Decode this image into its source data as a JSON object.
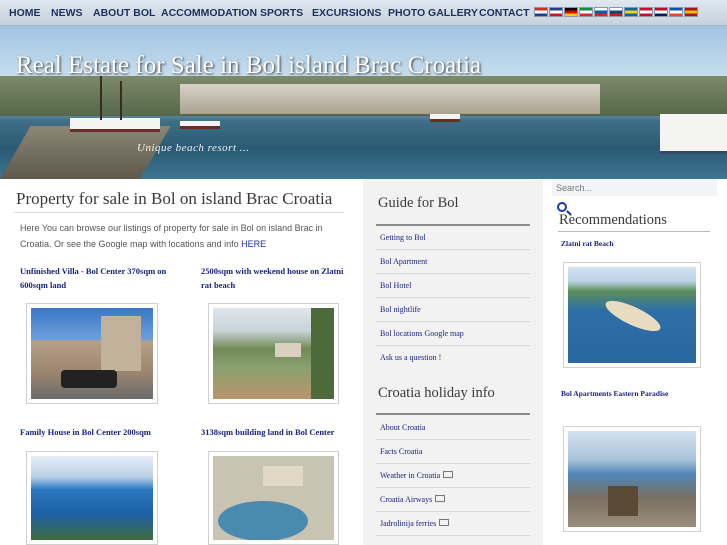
{
  "nav": {
    "items": [
      "HOME",
      "NEWS",
      "ABOUT BOL",
      "ACCOMMODATION",
      "SPORTS",
      "EXCURSIONS",
      "PHOTO GALLERY",
      "CONTACT"
    ],
    "flags": [
      {
        "name": "croatian-flag-icon",
        "colors": [
          "#d52b1e",
          "#ffffff",
          "#1f3f8f"
        ]
      },
      {
        "name": "english-flag-icon",
        "colors": [
          "#1f3f8f",
          "#ffffff",
          "#cf142b"
        ]
      },
      {
        "name": "german-flag-icon",
        "colors": [
          "#000000",
          "#dd0000",
          "#ffce00"
        ]
      },
      {
        "name": "italian-flag-icon",
        "colors": [
          "#009246",
          "#ffffff",
          "#ce2b37"
        ]
      },
      {
        "name": "slovenian-flag-icon",
        "colors": [
          "#ffffff",
          "#005da4",
          "#ed1c24"
        ]
      },
      {
        "name": "czech-flag-icon",
        "colors": [
          "#ffffff",
          "#11457e",
          "#d7141a"
        ]
      },
      {
        "name": "swedish-flag-icon",
        "colors": [
          "#006aa7",
          "#fecc00",
          "#006aa7"
        ]
      },
      {
        "name": "danish-flag-icon",
        "colors": [
          "#c8102e",
          "#ffffff",
          "#c8102e"
        ]
      },
      {
        "name": "norwegian-flag-icon",
        "colors": [
          "#ba0c2f",
          "#ffffff",
          "#00205b"
        ]
      },
      {
        "name": "french-flag-icon",
        "colors": [
          "#0055a4",
          "#ffffff",
          "#ef4135"
        ]
      },
      {
        "name": "spanish-flag-icon",
        "colors": [
          "#aa151b",
          "#f1bf00",
          "#aa151b"
        ]
      }
    ]
  },
  "header": {
    "title": "Real Estate for Sale in Bol island Brac Croatia",
    "subtitle": "Unique beach resort ..."
  },
  "main": {
    "title": "Property for sale in Bol on island Brac Croatia",
    "intro": "Here You can browse our listings of property for sale in Bol on island Brac in Croatia. Or see the Google map with locations and info",
    "intro_link": "HERE",
    "properties": [
      {
        "title": "Unfinished Villa - Bol Center 370sqm on 600sqm land"
      },
      {
        "title": "2500sqm with weekend house on Zlatni rat beach"
      },
      {
        "title": "Family House in Bol Center 200sqm"
      },
      {
        "title": "3138sqm building land in Bol Center"
      }
    ]
  },
  "guide": {
    "title": "Guide for Bol",
    "links": [
      "Getting to Bol",
      "Bol Apartment",
      "Bol Hotel",
      "Bol nightlife",
      "Bol locations Google map",
      "Ask us a question !"
    ]
  },
  "holiday": {
    "title": "Croatia holiday info",
    "links": [
      "About Croatia",
      "Facts Croatia",
      "Weather in Croatia",
      "Croatia Airways",
      "Jadrolinija ferries"
    ]
  },
  "sidebar": {
    "search_placeholder": "Search...",
    "recommendations_title": "Recommendations",
    "items": [
      {
        "title": "Zlatni rat Beach"
      },
      {
        "title": "Bol Apartments Eastern Paradise"
      }
    ]
  }
}
